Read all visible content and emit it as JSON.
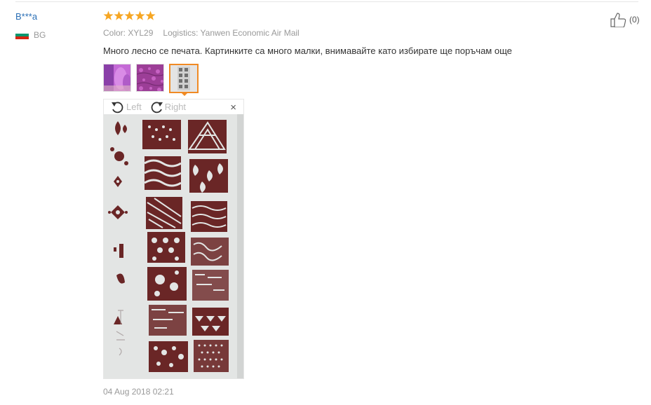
{
  "reviewer": {
    "name": "B***a",
    "country_code": "BG",
    "flag_colors": [
      "#ffffff",
      "#00966e",
      "#d62612"
    ]
  },
  "rating": {
    "stars": 5,
    "max": 5,
    "color": "#f6a623"
  },
  "meta": {
    "color_label": "Color:",
    "color_value": "XYL29",
    "logistics_label": "Logistics:",
    "logistics_value": "Yanwen Economic Air Mail"
  },
  "review_text": "Много лесно се печата. Картинките са много малки, внимавайте като избирате ще поръчам още",
  "thumbnails": [
    {
      "name": "purple-nails"
    },
    {
      "name": "purple-pattern"
    },
    {
      "name": "stamping-plate",
      "active": true
    }
  ],
  "viewer": {
    "rotate_left": "Left",
    "rotate_right": "Right",
    "close": "×"
  },
  "date": "04 Aug 2018 02:21",
  "helpful": {
    "count": "(0)"
  },
  "accent_color": "#f08a24"
}
